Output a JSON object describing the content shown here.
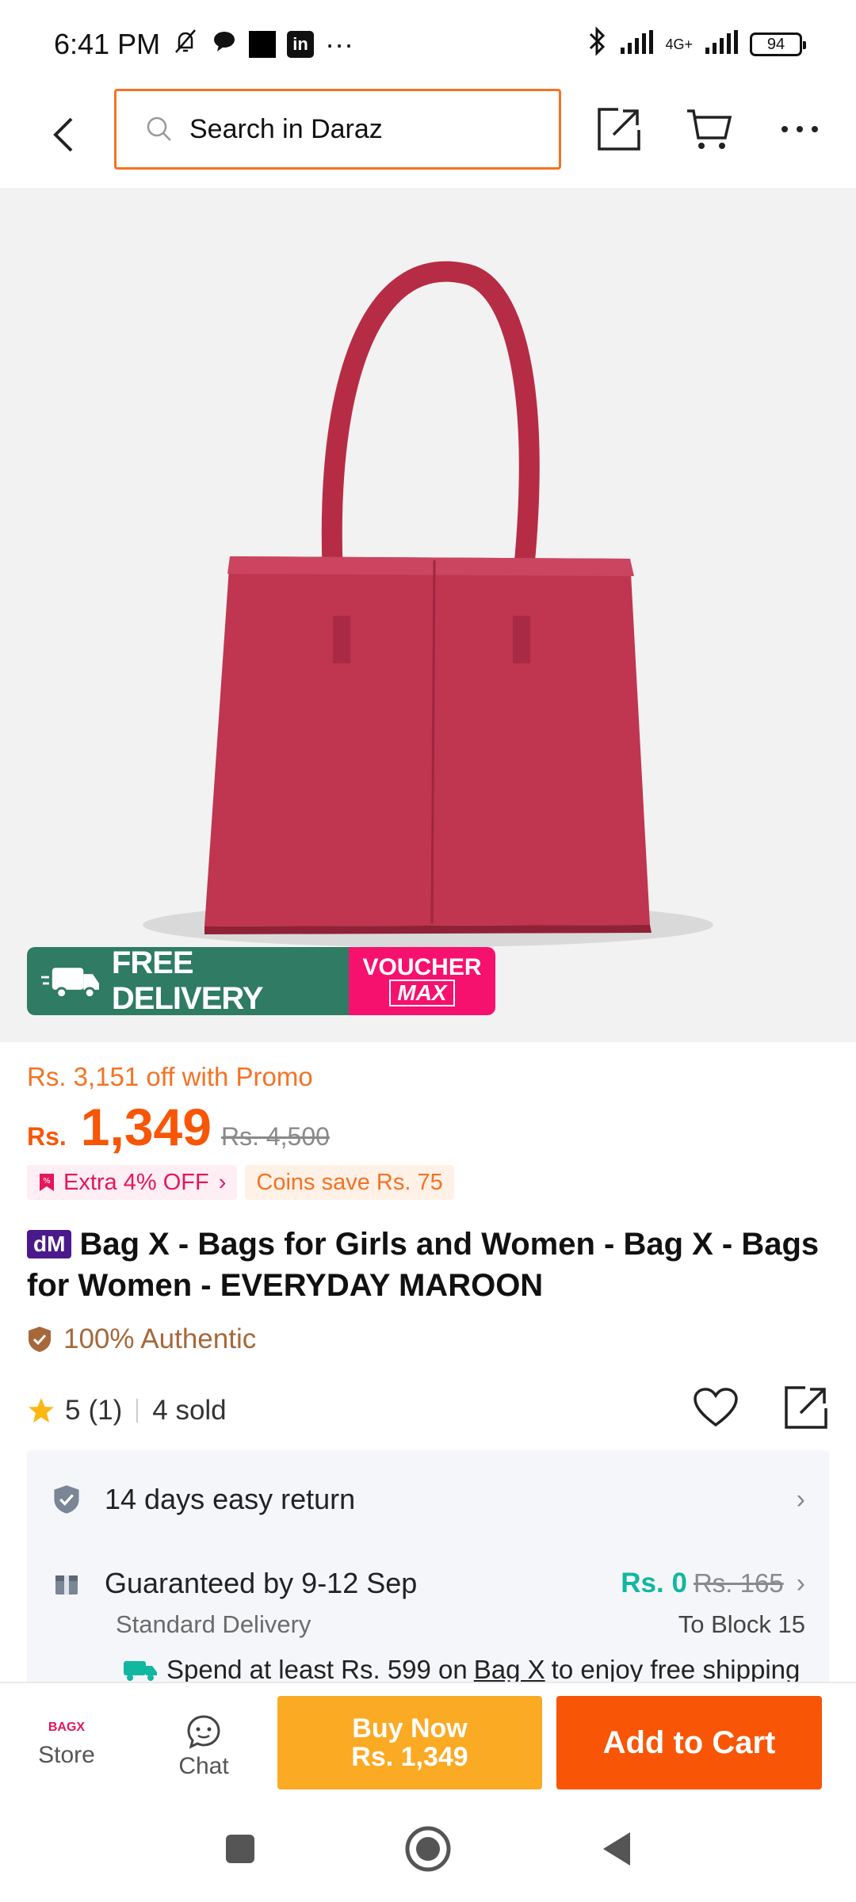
{
  "status_bar": {
    "time": "6:41 PM",
    "more": "···",
    "network": "4G+",
    "battery": "94"
  },
  "header": {
    "search_placeholder": "Search in Daraz"
  },
  "badges": {
    "free_delivery": "FREE DELIVERY",
    "free_tag": "FREE",
    "voucher": "VOUCHER",
    "voucher_max": "MAX"
  },
  "price": {
    "promo": "Rs. 3,151 off with Promo",
    "currency": "Rs.",
    "amount": "1,349",
    "original": "Rs. 4,500",
    "extra_off": "Extra 4% OFF",
    "coins_save": "Coins save Rs. 75"
  },
  "product": {
    "dm_badge": "dM",
    "title": "Bag X - Bags for Girls and Women - Bag X - Bags for Women - EVERYDAY MAROON",
    "authentic": "100% Authentic",
    "rating": "5",
    "rating_count": "(1)",
    "sold": "4 sold"
  },
  "services": {
    "return_text": "14 days easy return",
    "delivery_text": "Guaranteed by 9-12 Sep",
    "delivery_fee": "Rs. 0",
    "delivery_fee_old": "Rs. 165",
    "delivery_type": "Standard Delivery",
    "delivery_to": "To Block 15",
    "spend_prefix": "Spend at least Rs. 599 on",
    "spend_seller": "Bag X",
    "spend_suffix": "to enjoy free shipping"
  },
  "bottom_bar": {
    "store_logo": "BAGX",
    "store_label": "Store",
    "chat_label": "Chat",
    "buy_now_label": "Buy Now",
    "buy_now_price": "Rs. 1,349",
    "add_to_cart_label": "Add to Cart"
  },
  "colors": {
    "accent": "#f85606",
    "search_border": "#f57224",
    "buy_now": "#fbaa24",
    "free_delivery_green": "#2f7b63",
    "voucher_pink": "#f6116f",
    "bag": "#c03550"
  }
}
